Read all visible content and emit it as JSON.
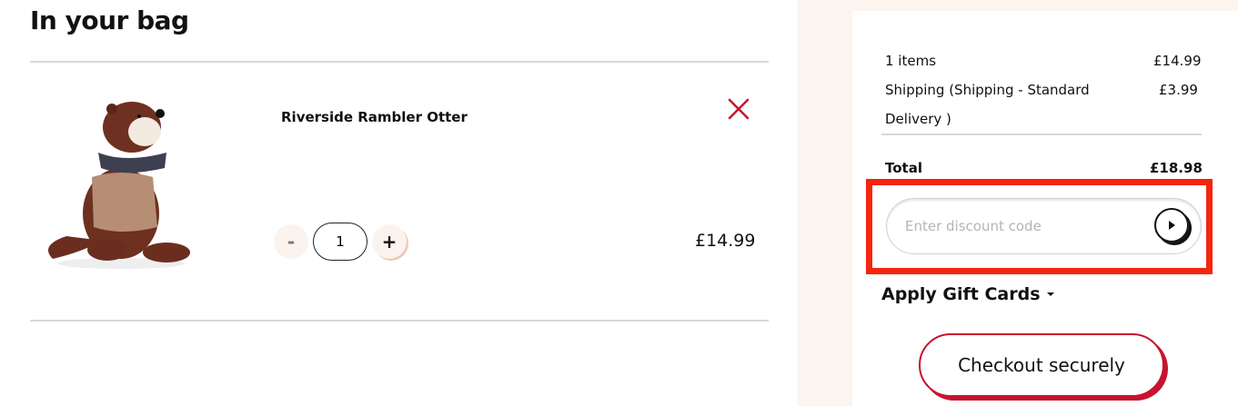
{
  "bag": {
    "title": "In your bag"
  },
  "item": {
    "name": "Riverside Rambler Otter",
    "quantity": "1",
    "price": "£14.99",
    "minus_label": "-",
    "plus_label": "+"
  },
  "summary": {
    "items_label": "1 items",
    "items_value": "£14.99",
    "shipping_label": "Shipping (Shipping - Standard Delivery )",
    "shipping_value": "£3.99",
    "total_label": "Total",
    "total_value": "£18.98"
  },
  "discount": {
    "placeholder": "Enter discount code",
    "value": ""
  },
  "gift_cards": {
    "label": "Apply Gift Cards"
  },
  "checkout": {
    "label": "Checkout securely"
  },
  "colors": {
    "accent": "#c71430",
    "highlight": "#f5250d",
    "sidebar_bg": "#fcf4ef"
  }
}
